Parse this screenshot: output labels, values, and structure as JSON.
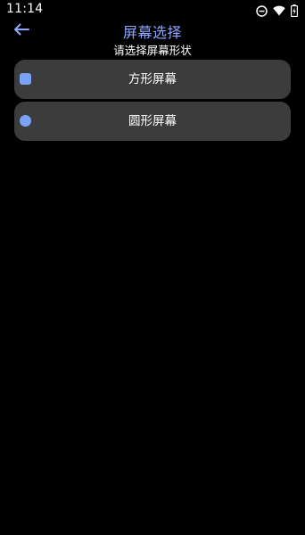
{
  "status_bar": {
    "time": "11:14",
    "icons": [
      "do-not-disturb-icon",
      "wifi-icon",
      "battery-charging-icon"
    ]
  },
  "header": {
    "title": "屏幕选择",
    "subtitle": "请选择屏幕形状",
    "back_icon": "back-arrow-icon"
  },
  "options": [
    {
      "label": "方形屏幕",
      "indicator": "square"
    },
    {
      "label": "圆形屏幕",
      "indicator": "circle"
    }
  ],
  "colors": {
    "background": "#000000",
    "card": "#3c3c3c",
    "accent": "#7aa2f7",
    "title": "#8fa8ff",
    "text": "#ffffff"
  }
}
